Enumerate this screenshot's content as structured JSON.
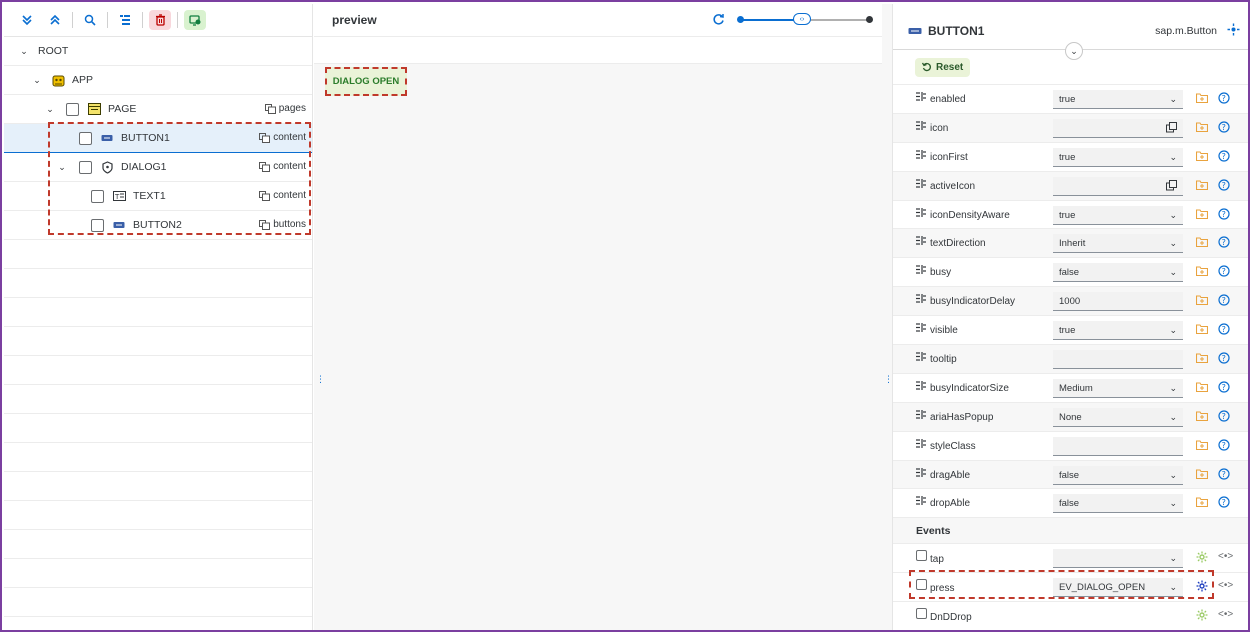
{
  "tree": {
    "toolbar_icons": [
      "expand-all-icon",
      "collapse-all-icon",
      "search-icon",
      "outline-icon",
      "delete-icon",
      "add-element-icon"
    ],
    "nodes": [
      {
        "label": "ROOT",
        "aggregation": ""
      },
      {
        "label": "APP",
        "aggregation": ""
      },
      {
        "label": "PAGE",
        "aggregation": "pages"
      },
      {
        "label": "BUTTON1",
        "aggregation": "content"
      },
      {
        "label": "DIALOG1",
        "aggregation": "content"
      },
      {
        "label": "TEXT1",
        "aggregation": "content"
      },
      {
        "label": "BUTTON2",
        "aggregation": "buttons"
      }
    ]
  },
  "preview": {
    "title": "preview",
    "dialog_button_label": "DIALOG OPEN"
  },
  "properties": {
    "title": "BUTTON1",
    "class_name": "sap.m.Button",
    "reset_label": "Reset",
    "rows": [
      {
        "name": "enabled",
        "value": "true",
        "kind": "dropdown"
      },
      {
        "name": "icon",
        "value": "",
        "kind": "valuehelp"
      },
      {
        "name": "iconFirst",
        "value": "true",
        "kind": "dropdown"
      },
      {
        "name": "activeIcon",
        "value": "",
        "kind": "valuehelp"
      },
      {
        "name": "iconDensityAware",
        "value": "true",
        "kind": "dropdown"
      },
      {
        "name": "textDirection",
        "value": "Inherit",
        "kind": "dropdown"
      },
      {
        "name": "busy",
        "value": "false",
        "kind": "dropdown"
      },
      {
        "name": "busyIndicatorDelay",
        "value": "1000",
        "kind": "text"
      },
      {
        "name": "visible",
        "value": "true",
        "kind": "dropdown"
      },
      {
        "name": "tooltip",
        "value": "",
        "kind": "text"
      },
      {
        "name": "busyIndicatorSize",
        "value": "Medium",
        "kind": "dropdown"
      },
      {
        "name": "ariaHasPopup",
        "value": "None",
        "kind": "dropdown"
      },
      {
        "name": "styleClass",
        "value": "",
        "kind": "text"
      },
      {
        "name": "dragAble",
        "value": "false",
        "kind": "dropdown"
      },
      {
        "name": "dropAble",
        "value": "false",
        "kind": "dropdown"
      }
    ],
    "events_header": "Events",
    "events": [
      {
        "name": "tap",
        "value": "",
        "has_dropdown": true
      },
      {
        "name": "press",
        "value": "EV_DIALOG_OPEN",
        "has_dropdown": true
      },
      {
        "name": "DnDDrop",
        "value": "",
        "has_dropdown": false
      }
    ]
  },
  "colors": {
    "accent": "#0a6ed1",
    "highlight": "#c0392b",
    "frame": "#7b3fa0",
    "dialog_button_bg": "#eaf3d8"
  }
}
